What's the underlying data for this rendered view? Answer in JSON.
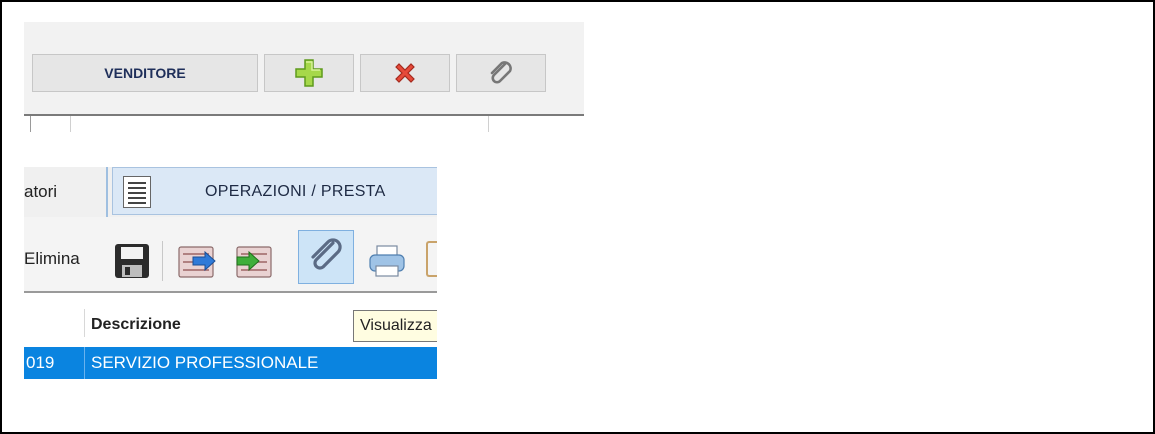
{
  "seller_panel": {
    "seller_button_label": "VENDITORE",
    "add_icon": "plus-icon",
    "delete_icon": "x-icon",
    "attach_icon": "paperclip-icon"
  },
  "tabs": {
    "previous_tab_fragment": "atori",
    "active_tab_icon": "list-icon",
    "active_tab_label": "OPERAZIONI / PRESTA"
  },
  "toolbar": {
    "delete_label_fragment": "Elimina",
    "icons": [
      "save-icon",
      "export-icon",
      "import-icon",
      "paperclip-icon",
      "print-icon"
    ]
  },
  "table": {
    "column_description": "Descrizione",
    "tooltip": "Visualizza",
    "selected_row": {
      "number_fragment": "019",
      "description": "SERVIZIO PROFESSIONALE"
    }
  },
  "colors": {
    "selection": "#0a84e0",
    "tab_active": "#dbe8f6",
    "tooltip_bg": "#fffde1"
  }
}
